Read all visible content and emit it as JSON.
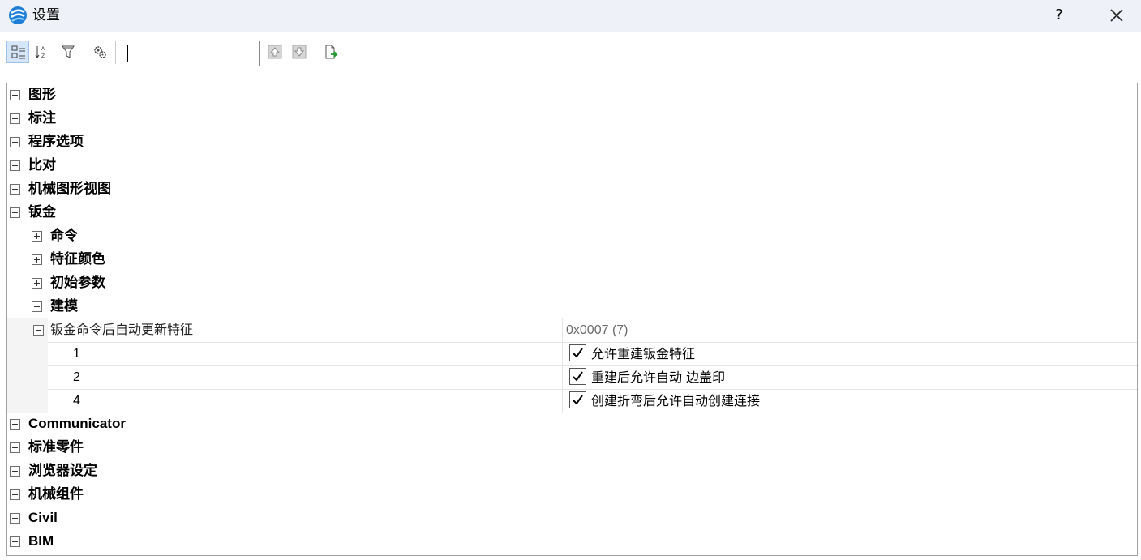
{
  "window": {
    "title": "设置",
    "help_label": "?"
  },
  "toolbar": {
    "buttons": [
      "categorized-view-icon",
      "sort-az-icon",
      "filter-icon",
      "settings-gears-icon",
      "move-up-icon",
      "move-down-icon",
      "export-icon"
    ],
    "search": {
      "value": "",
      "placeholder": ""
    }
  },
  "tree": {
    "top1": [
      "图形",
      "标注",
      "程序选项",
      "比对",
      "机械图形视图"
    ],
    "sheetmetal": {
      "label": "钣金",
      "children": [
        "命令",
        "特征颜色",
        "初始参数",
        "建模"
      ],
      "setting": {
        "name": "钣金命令后自动更新特征",
        "value": "0x0007 (7)",
        "flags": [
          {
            "bit": "1",
            "label": "允许重建钣金特征",
            "checked": true
          },
          {
            "bit": "2",
            "label": "重建后允许自动 边盖印",
            "checked": true
          },
          {
            "bit": "4",
            "label": "创建折弯后允许自动创建连接",
            "checked": true
          }
        ]
      }
    },
    "top2": [
      "Communicator",
      "标准零件",
      "浏览器设定",
      "机械组件",
      "Civil",
      "BIM"
    ]
  },
  "colors": {
    "titlebar": "#eef2f8",
    "active_button": "#d4e6f7",
    "tree_border": "#a0a0a0",
    "value_text": "#6b6b6b"
  }
}
